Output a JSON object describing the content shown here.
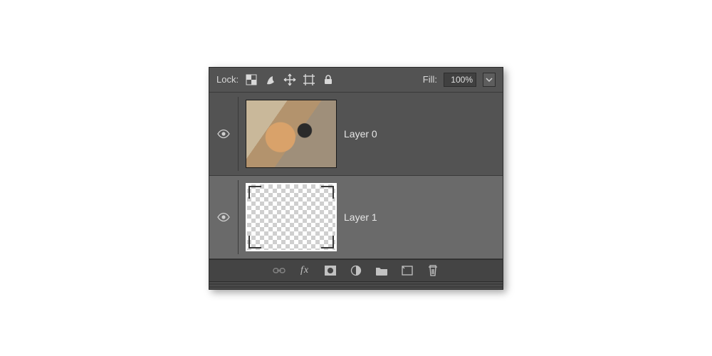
{
  "lockRow": {
    "label": "Lock:",
    "fillLabel": "Fill:",
    "fillValue": "100%"
  },
  "layers": [
    {
      "name": "Layer 0",
      "visible": true,
      "selected": false,
      "thumb": "photo"
    },
    {
      "name": "Layer 1",
      "visible": true,
      "selected": true,
      "thumb": "transparent"
    }
  ]
}
